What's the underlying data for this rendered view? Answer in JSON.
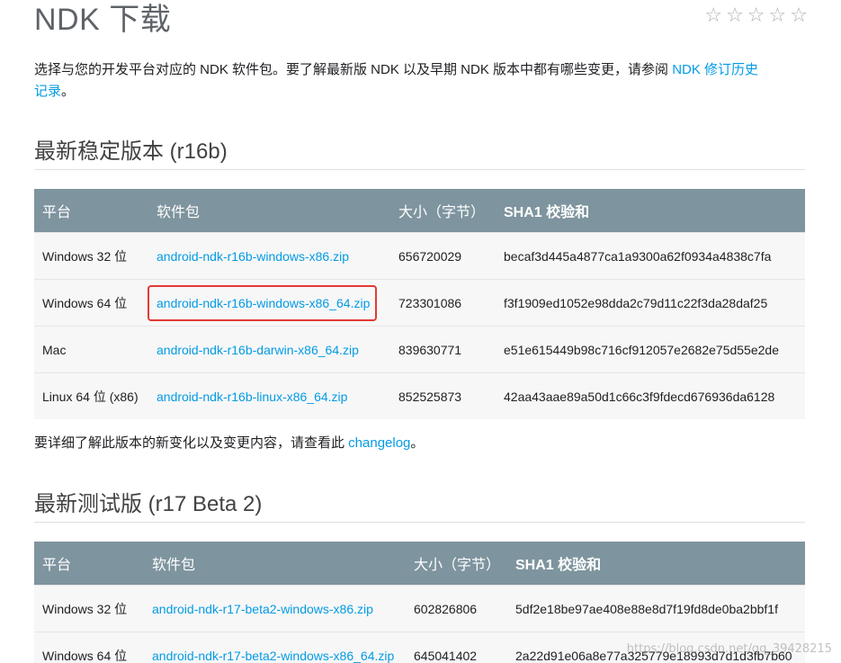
{
  "title": "NDK 下载",
  "rating": {
    "stars": [
      "☆",
      "☆",
      "☆",
      "☆",
      "☆"
    ]
  },
  "intro": {
    "text": "选择与您的开发平台对应的 NDK 软件包。要了解最新版 NDK 以及早期 NDK 版本中都有哪些变更，请参阅 ",
    "link_text_1": "NDK 修订历史",
    "link_text_2": "记录",
    "suffix": "。"
  },
  "stable": {
    "heading": "最新稳定版本 (r16b)",
    "headers": [
      "平台",
      "软件包",
      "大小（字节）",
      "SHA1 校验和"
    ],
    "rows": [
      {
        "platform": "Windows 32 位",
        "package": "android-ndk-r16b-windows-x86.zip",
        "size": "656720029",
        "sha1": "becaf3d445a4877ca1a9300a62f0934a4838c7fa"
      },
      {
        "platform": "Windows 64 位",
        "package": "android-ndk-r16b-windows-x86_64.zip",
        "size": "723301086",
        "sha1": "f3f1909ed1052e98dda2c79d11c22f3da28daf25"
      },
      {
        "platform": "Mac",
        "package": "android-ndk-r16b-darwin-x86_64.zip",
        "size": "839630771",
        "sha1": "e51e615449b98c716cf912057e2682e75d55e2de"
      },
      {
        "platform": "Linux 64 位 (x86)",
        "package": "android-ndk-r16b-linux-x86_64.zip",
        "size": "852525873",
        "sha1": "42aa43aae89a50d1c66c3f9fdecd676936da6128"
      }
    ]
  },
  "changelog_note": {
    "text": "要详细了解此版本的新变化以及变更内容，请查看此 ",
    "link_text": "changelog",
    "suffix": "。"
  },
  "beta": {
    "heading": "最新测试版 (r17 Beta 2)",
    "headers": [
      "平台",
      "软件包",
      "大小（字节）",
      "SHA1 校验和"
    ],
    "rows": [
      {
        "platform": "Windows 32 位",
        "package": "android-ndk-r17-beta2-windows-x86.zip",
        "size": "602826806",
        "sha1": "5df2e18be97ae408e88e8d7f19fd8de0ba2bbf1f"
      },
      {
        "platform": "Windows 64 位",
        "package": "android-ndk-r17-beta2-windows-x86_64.zip",
        "size": "645041402",
        "sha1": "2a22d91e06a8e77a325779e18993d7d1d3fb7b60"
      }
    ]
  },
  "watermark": "https://blog.csdn.net/qq_39428215"
}
